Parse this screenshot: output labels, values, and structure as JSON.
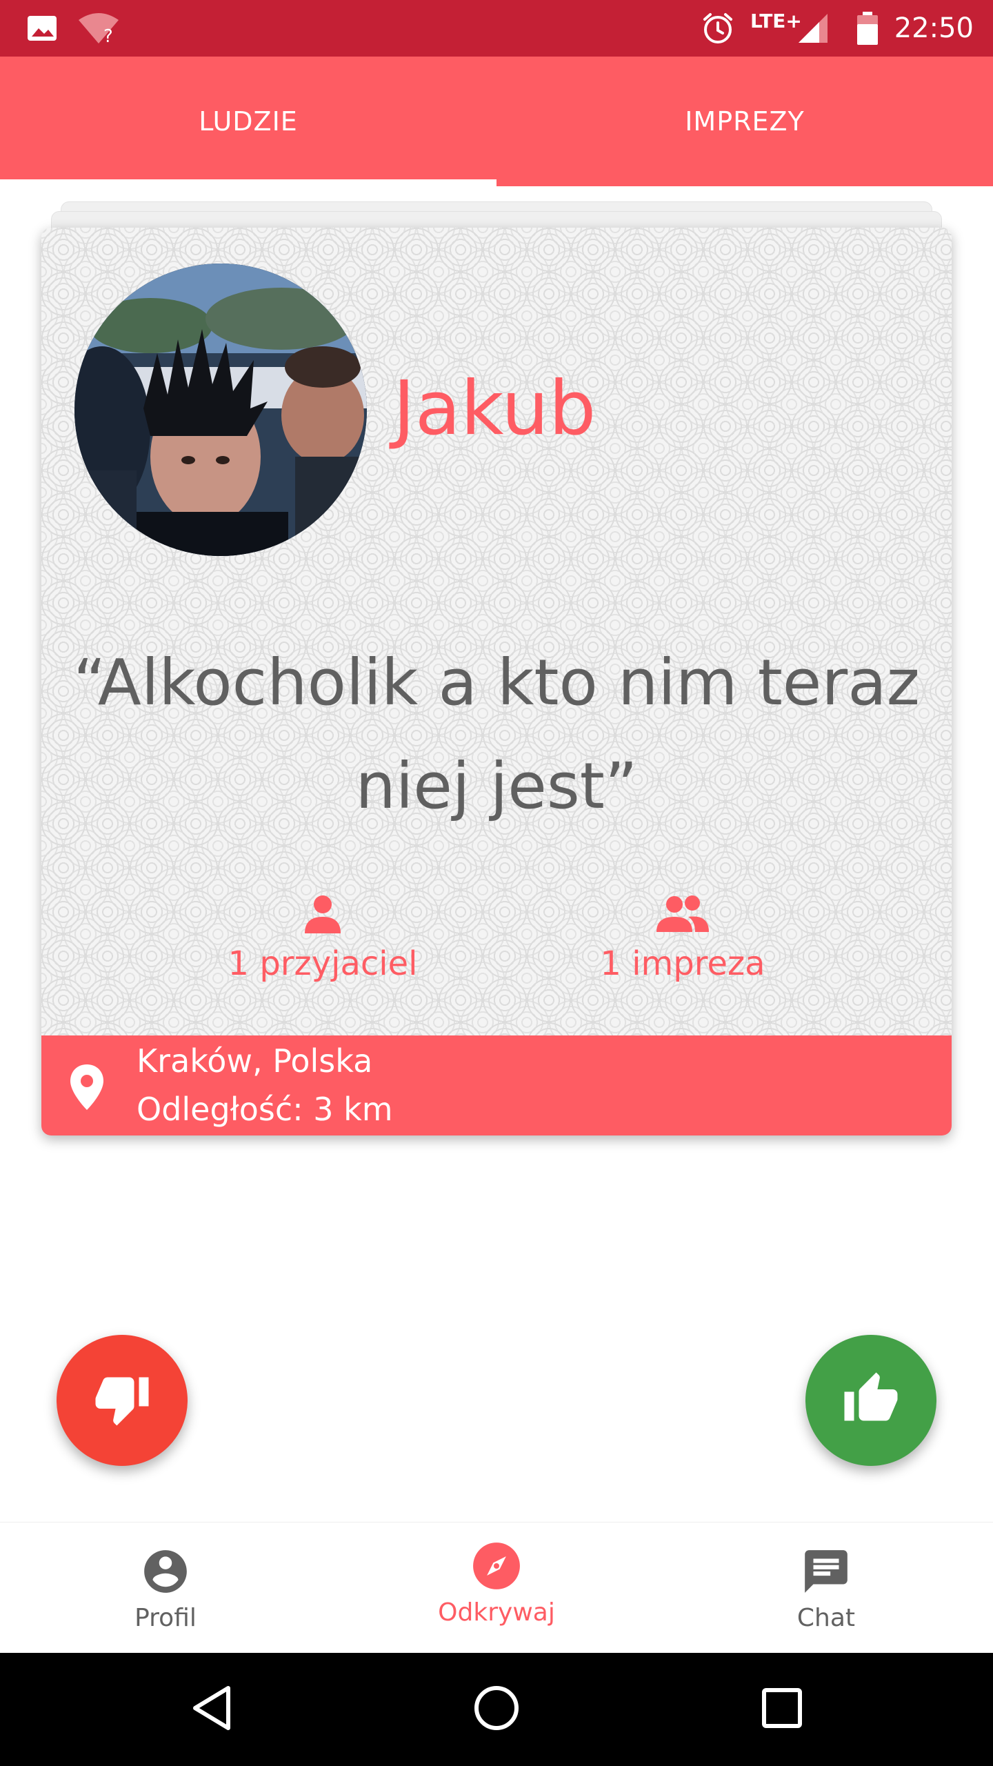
{
  "status_bar": {
    "time": "22:50",
    "network": "LTE+",
    "icons": [
      "image-icon",
      "wifi-unknown-icon",
      "alarm-icon",
      "signal-icon",
      "battery-icon"
    ]
  },
  "tabs": [
    {
      "label": "LUDZIE",
      "selected": true
    },
    {
      "label": "IMPREZY",
      "selected": false
    }
  ],
  "profile": {
    "name": "Jakub",
    "quote_line1": "“Alkocholik a kto nim teraz",
    "quote_line2": "niej jest”",
    "friends_label": "1 przyjaciel",
    "events_label": "1 impreza",
    "location": "Kraków, Polska",
    "distance": "Odległość: 3 km"
  },
  "actions": {
    "dislike_icon": "thumb-down-icon",
    "like_icon": "thumb-up-icon"
  },
  "bottom_nav": {
    "items": [
      {
        "label": "Profil",
        "icon": "account-circle-icon",
        "active": false
      },
      {
        "label": "Odkrywaj",
        "icon": "compass-icon",
        "active": true
      },
      {
        "label": "Chat",
        "icon": "chat-icon",
        "active": false
      }
    ]
  },
  "colors": {
    "accent": "#fe5c63",
    "status_bar": "#c42035",
    "dislike": "#f44336",
    "like": "#43a047",
    "quote_text": "#606060",
    "inactive_nav": "#616161"
  }
}
